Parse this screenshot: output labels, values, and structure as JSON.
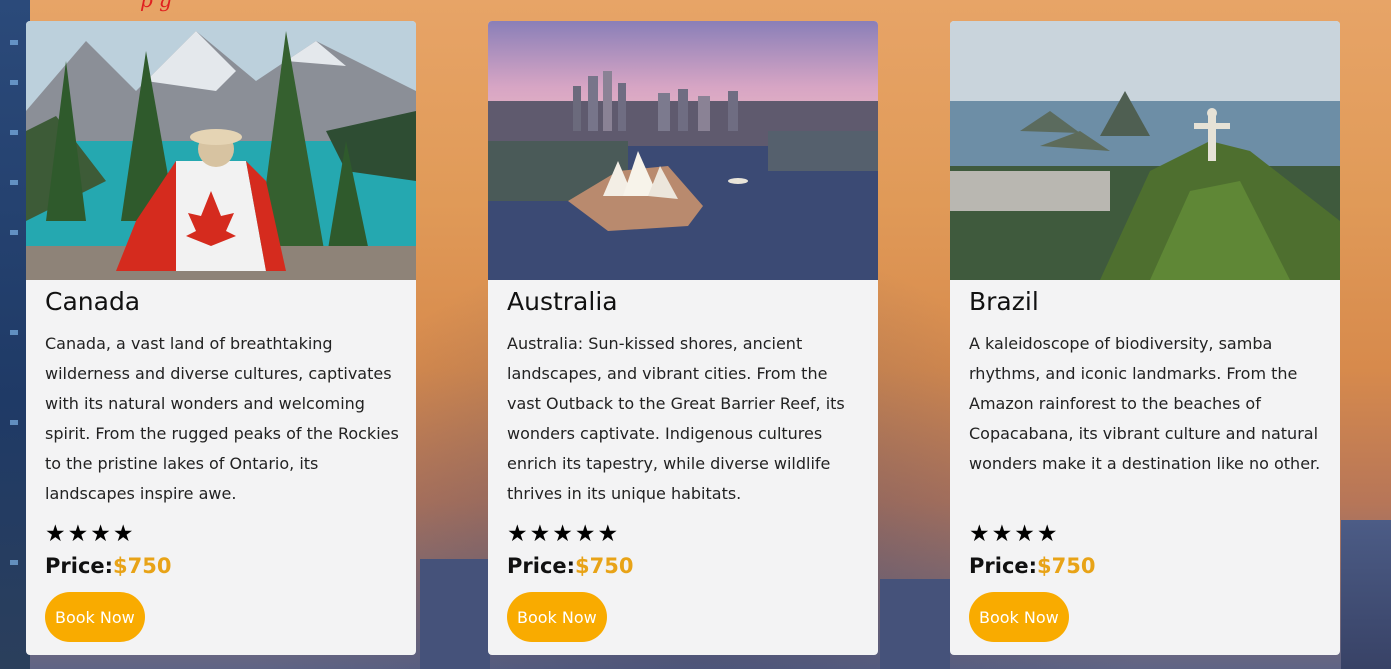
{
  "header": {
    "fragment": "p      g"
  },
  "cards": [
    {
      "title": "Canada",
      "description": "Canada, a vast land of breathtaking wilderness and diverse cultures, captivates with its natural wonders and welcoming spirit. From the rugged peaks of the Rockies to the pristine lakes of Ontario, its landscapes inspire awe.",
      "stars": "★★★★",
      "rating": 4,
      "price_label": "Price:",
      "price_value": "$750",
      "button_label": "Book Now"
    },
    {
      "title": "Australia",
      "description": "Australia: Sun-kissed shores, ancient landscapes, and vibrant cities. From the vast Outback to the Great Barrier Reef, its wonders captivate. Indigenous cultures enrich its tapestry, while diverse wildlife thrives in its unique habitats.",
      "stars": "★★★★★",
      "rating": 5,
      "price_label": "Price:",
      "price_value": "$750",
      "button_label": "Book Now"
    },
    {
      "title": "Brazil",
      "description": "A kaleidoscope of biodiversity, samba rhythms, and iconic landmarks. From the Amazon rainforest to the beaches of Copacabana, its vibrant culture and natural wonders make it a destination like no other.",
      "stars": "★★★★",
      "rating": 4,
      "price_label": "Price:",
      "price_value": "$750",
      "button_label": "Book Now"
    }
  ],
  "colors": {
    "accent": "#f9ab00",
    "price": "#e8a317",
    "card_bg": "#f3f3f4"
  }
}
